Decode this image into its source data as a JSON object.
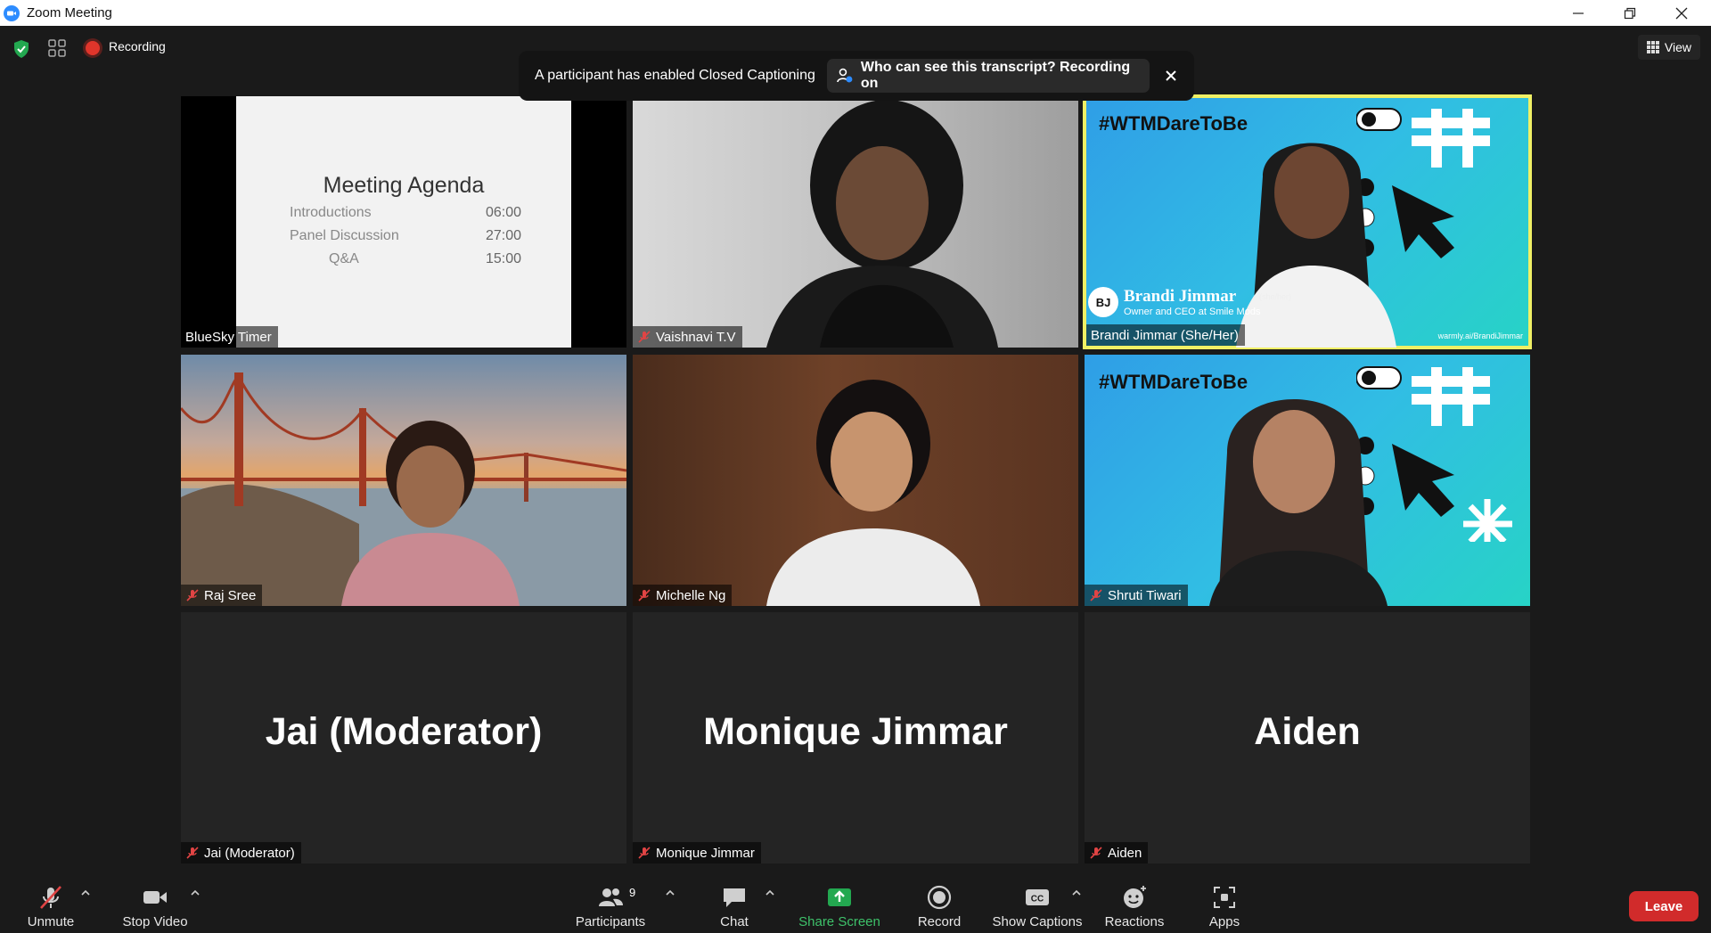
{
  "window": {
    "title": "Zoom Meeting"
  },
  "topbar": {
    "recording_label": "Recording",
    "view_label": "View"
  },
  "notice": {
    "message": "A participant has enabled Closed Captioning",
    "transcript_button": "Who can see this transcript? Recording on"
  },
  "tiles": [
    {
      "name": "BlueSky Timer",
      "muted": false,
      "type": "screen"
    },
    {
      "name": "Vaishnavi T.V",
      "muted": true,
      "type": "video"
    },
    {
      "name": "Brandi Jimmar (She/Her)",
      "muted": false,
      "type": "video",
      "active_speaker": true
    },
    {
      "name": "Raj Sree",
      "muted": true,
      "type": "video"
    },
    {
      "name": "Michelle Ng",
      "muted": true,
      "type": "video"
    },
    {
      "name": "Shruti Tiwari",
      "muted": true,
      "type": "video"
    },
    {
      "name": "Jai (Moderator)",
      "muted": true,
      "type": "avatar",
      "big_name": "Jai (Moderator)"
    },
    {
      "name": "Monique Jimmar",
      "muted": true,
      "type": "avatar",
      "big_name": "Monique Jimmar"
    },
    {
      "name": "Aiden",
      "muted": true,
      "type": "avatar",
      "big_name": "Aiden"
    }
  ],
  "slide": {
    "title": "Meeting Agenda",
    "rows": [
      {
        "item": "Introductions",
        "time": "06:00"
      },
      {
        "item": "Panel Discussion",
        "time": "27:00"
      },
      {
        "item": "Q&A",
        "time": "15:00"
      }
    ]
  },
  "overlay_brandi": {
    "hashtag": "#WTMDareToBe",
    "initials": "BJ",
    "name": "Brandi Jimmar",
    "pronouns": "(she/her)",
    "role": "Owner and CEO at Smile Mods",
    "link": "warmly.ai/BrandiJimmar"
  },
  "overlay_shruti": {
    "hashtag": "#WTMDareToBe"
  },
  "toolbar": {
    "unmute": "Unmute",
    "stop_video": "Stop Video",
    "participants": "Participants",
    "participants_count": "9",
    "chat": "Chat",
    "share_screen": "Share Screen",
    "record": "Record",
    "show_captions": "Show Captions",
    "reactions": "Reactions",
    "apps": "Apps",
    "leave": "Leave"
  },
  "colors": {
    "background": "#1a1a1a",
    "tile": "#242424",
    "active_speaker_border": "#f0f065",
    "recording_red": "#e0352b",
    "share_green": "#3ec26a",
    "leave_red": "#d12b2b"
  }
}
